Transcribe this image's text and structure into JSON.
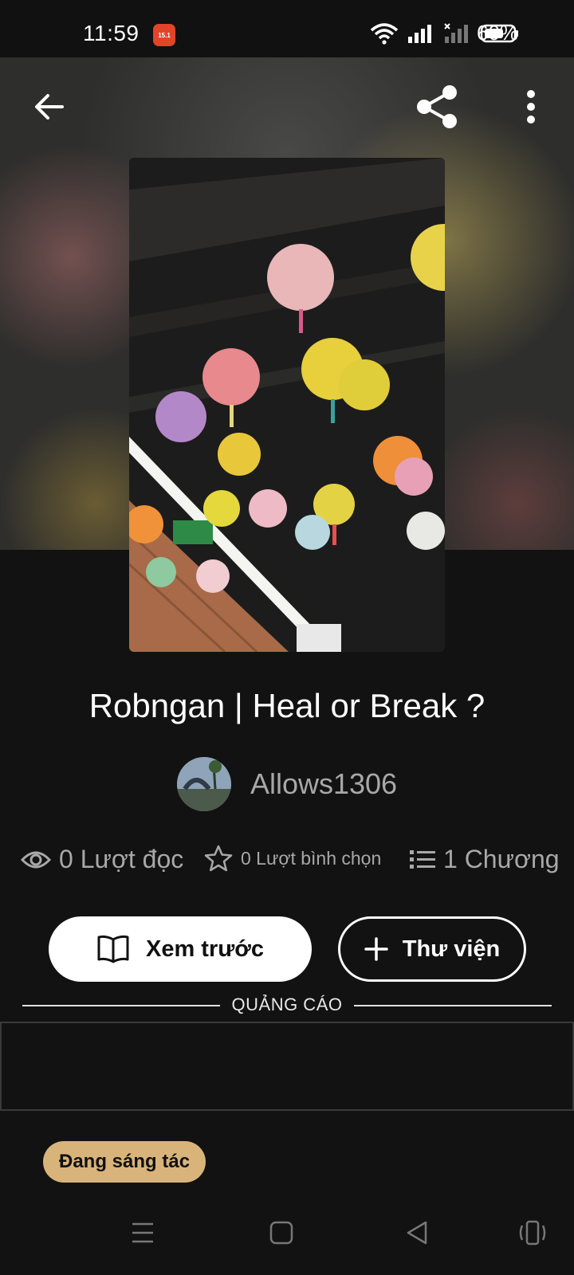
{
  "status_bar": {
    "time": "11:59",
    "shop_badge": "15.1",
    "battery": "60%"
  },
  "header": {
    "back_icon": "arrow-left-icon",
    "share_icon": "share-icon",
    "more_icon": "more-vertical-icon"
  },
  "story": {
    "title": "Robngan | Heal or Break ?",
    "author": "Allows1306",
    "status": "Đang sáng tác"
  },
  "stats": {
    "reads": "0 Lượt đọc",
    "votes": "0 Lượt bình chọn",
    "chapters": "1 Chương"
  },
  "actions": {
    "preview_label": "Xem trước",
    "library_label": "Thư viện"
  },
  "ad": {
    "label": "QUẢNG CÁO"
  },
  "colors": {
    "background": "#121212",
    "status_pill": "#d9b47a",
    "muted_text": "#a8a8a8"
  }
}
